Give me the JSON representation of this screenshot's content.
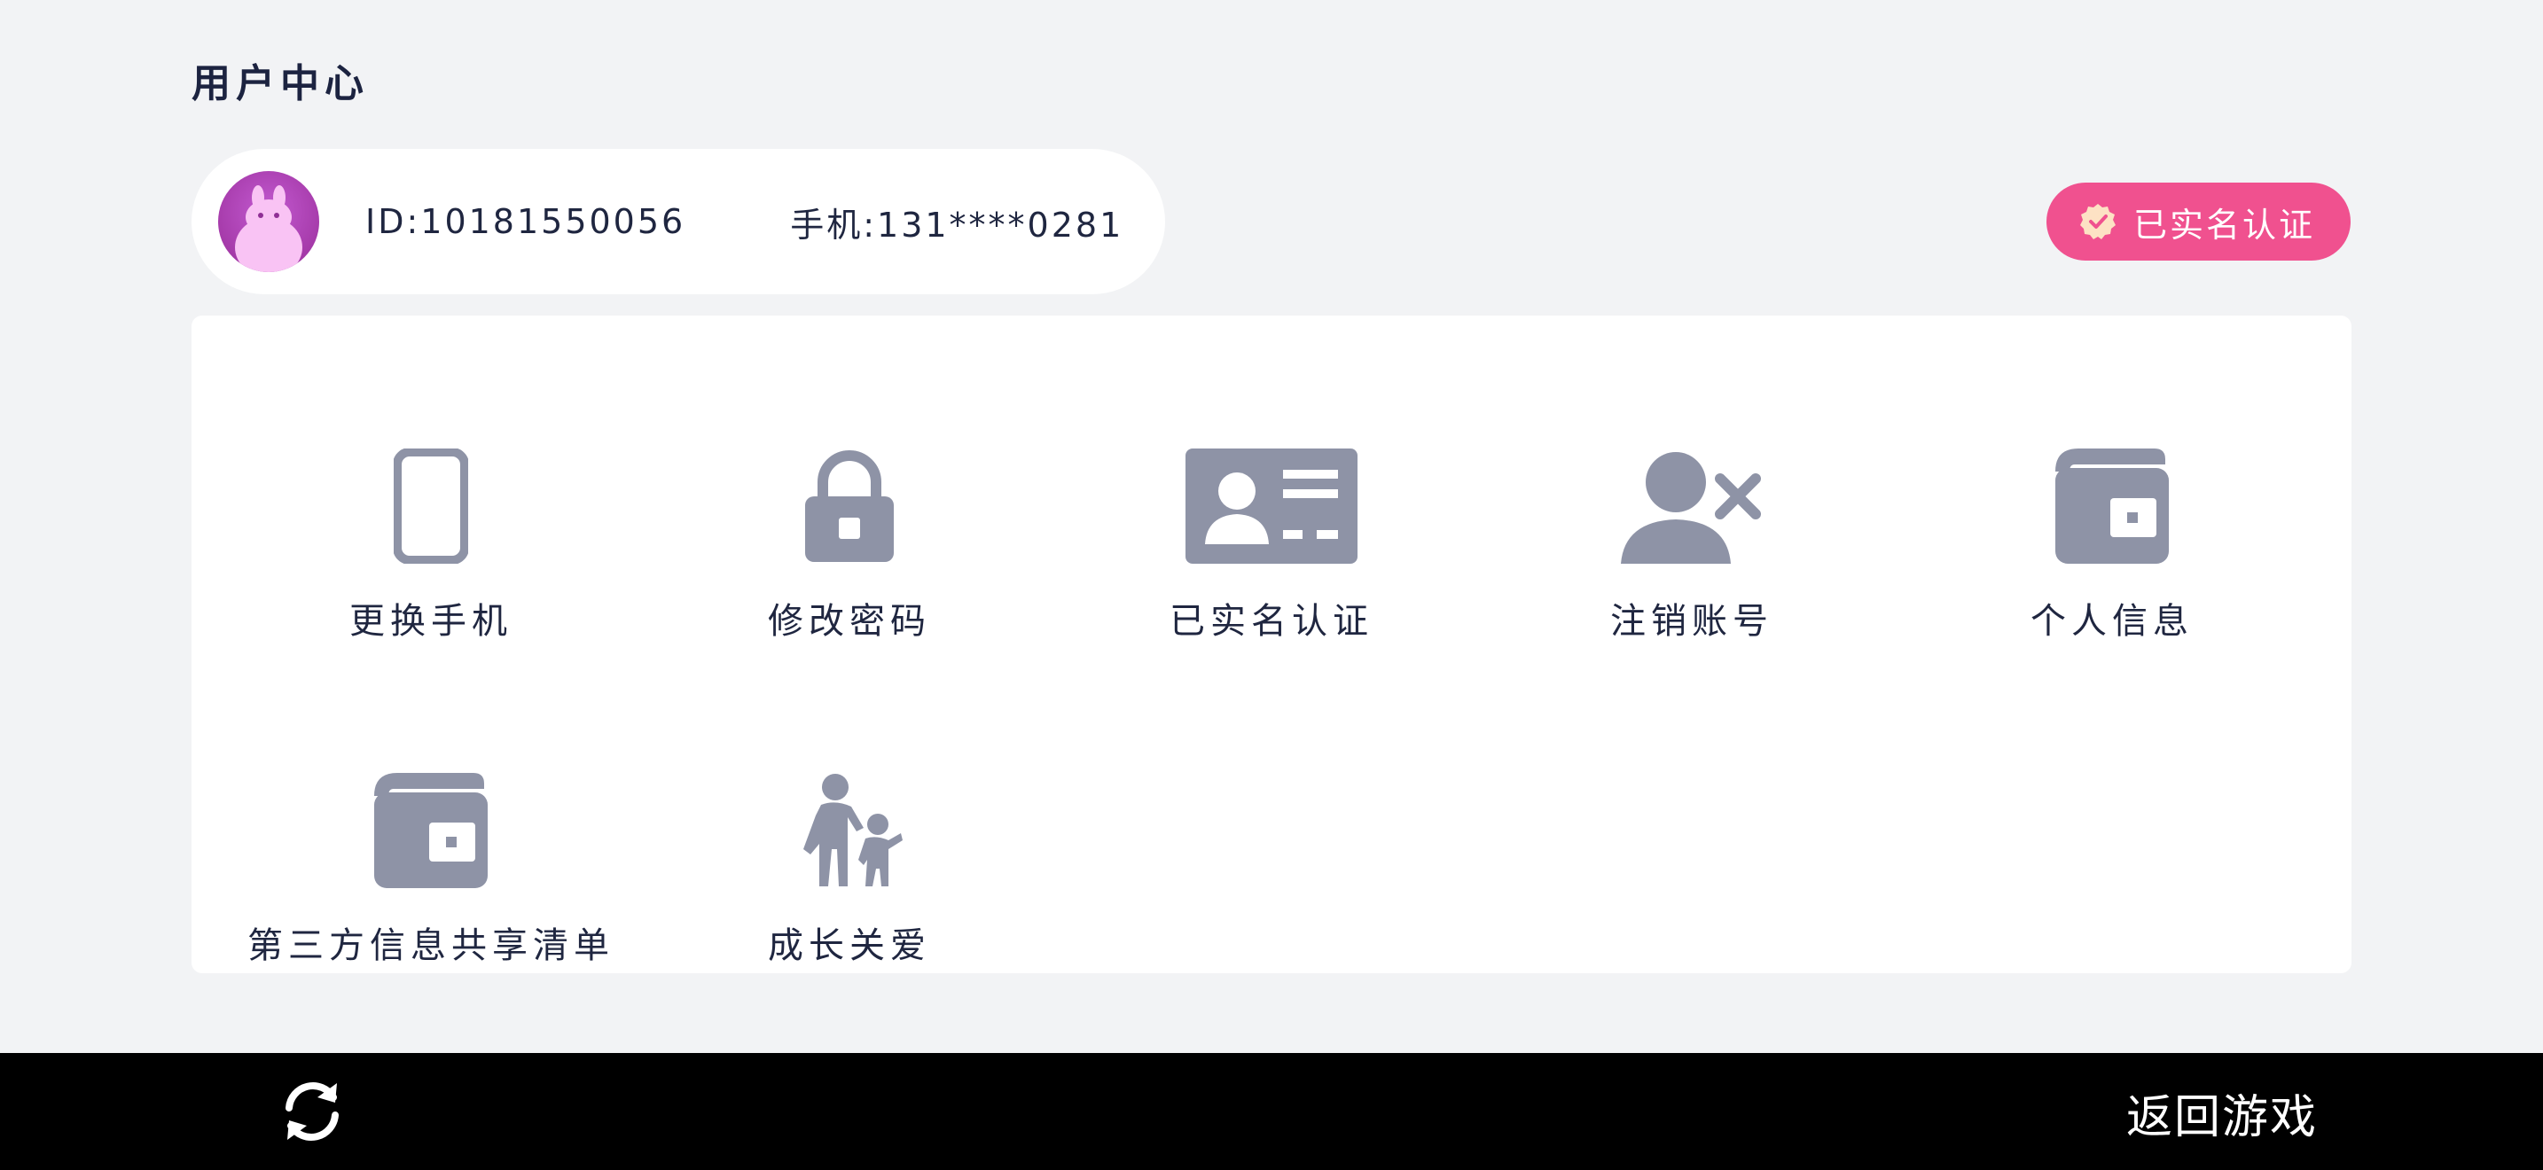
{
  "header": {
    "title": "用户中心"
  },
  "user": {
    "id_text": "ID:10181550056",
    "phone_text": "手机:131****0281"
  },
  "badge": {
    "label": "已实名认证",
    "color": "#f0518f"
  },
  "menu": {
    "items": [
      {
        "label": "更换手机",
        "icon": "phone-icon"
      },
      {
        "label": "修改密码",
        "icon": "lock-icon"
      },
      {
        "label": "已实名认证",
        "icon": "id-card-icon"
      },
      {
        "label": "注销账号",
        "icon": "user-remove-icon"
      },
      {
        "label": "个人信息",
        "icon": "wallet-icon"
      },
      {
        "label": "第三方信息共享清单",
        "icon": "wallet-icon"
      },
      {
        "label": "成长关爱",
        "icon": "parent-child-icon"
      }
    ]
  },
  "footer": {
    "return_label": "返回游戏",
    "refresh_icon": "refresh-icon"
  },
  "colors": {
    "icon_gray": "#8e93a6",
    "background": "#f2f3f5",
    "accent_pink": "#f0518f"
  }
}
